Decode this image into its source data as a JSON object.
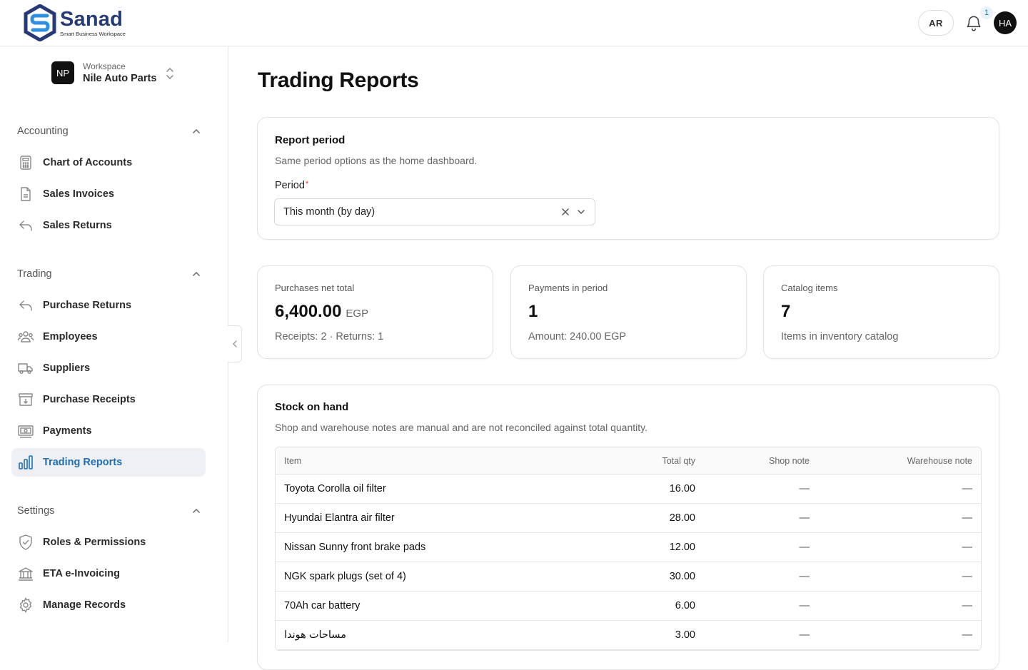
{
  "brand": {
    "name": "Sanad",
    "tagline": "Smart Business Workspace"
  },
  "header": {
    "lang_label": "AR",
    "notification_count": "1",
    "user_initials": "HA"
  },
  "workspace": {
    "initials": "NP",
    "label": "Workspace",
    "name": "Nile Auto Parts"
  },
  "sidebar": {
    "sections": [
      {
        "title": "Accounting",
        "items": [
          {
            "label": "Chart of Accounts",
            "icon": "calculator-icon"
          },
          {
            "label": "Sales Invoices",
            "icon": "document-icon"
          },
          {
            "label": "Sales Returns",
            "icon": "return-arrow-icon"
          }
        ]
      },
      {
        "title": "Trading",
        "items": [
          {
            "label": "Purchase Returns",
            "icon": "return-arrow-icon"
          },
          {
            "label": "Employees",
            "icon": "users-icon"
          },
          {
            "label": "Suppliers",
            "icon": "truck-icon"
          },
          {
            "label": "Purchase Receipts",
            "icon": "archive-box-icon"
          },
          {
            "label": "Payments",
            "icon": "banknote-icon"
          },
          {
            "label": "Trading Reports",
            "icon": "bar-chart-icon",
            "active": true
          }
        ]
      },
      {
        "title": "Settings",
        "items": [
          {
            "label": "Roles & Permissions",
            "icon": "shield-check-icon"
          },
          {
            "label": "ETA e-Invoicing",
            "icon": "bank-building-icon"
          },
          {
            "label": "Manage Records",
            "icon": "gear-icon"
          }
        ]
      }
    ]
  },
  "page": {
    "title": "Trading Reports"
  },
  "period_card": {
    "title": "Report period",
    "subtitle": "Same period options as the home dashboard.",
    "field_label": "Period",
    "required_mark": "*",
    "selected": "This month (by day)"
  },
  "stats": [
    {
      "label": "Purchases net total",
      "value": "6,400.00",
      "unit": "EGP",
      "footer": "Receipts: 2 · Returns: 1"
    },
    {
      "label": "Payments in period",
      "value": "1",
      "unit": "",
      "footer": "Amount: 240.00 EGP"
    },
    {
      "label": "Catalog items",
      "value": "7",
      "unit": "",
      "footer": "Items in inventory catalog"
    }
  ],
  "stock": {
    "title": "Stock on hand",
    "subtitle": "Shop and warehouse notes are manual and are not reconciled against total quantity.",
    "columns": [
      "Item",
      "Total qty",
      "Shop note",
      "Warehouse note"
    ],
    "rows": [
      {
        "item": "Toyota Corolla oil filter",
        "qty": "16.00",
        "shop": "—",
        "warehouse": "—"
      },
      {
        "item": "Hyundai Elantra air filter",
        "qty": "28.00",
        "shop": "—",
        "warehouse": "—"
      },
      {
        "item": "Nissan Sunny front brake pads",
        "qty": "12.00",
        "shop": "—",
        "warehouse": "—"
      },
      {
        "item": "NGK spark plugs (set of 4)",
        "qty": "30.00",
        "shop": "—",
        "warehouse": "—"
      },
      {
        "item": "70Ah car battery",
        "qty": "6.00",
        "shop": "—",
        "warehouse": "—"
      },
      {
        "item": "مساحات هوندا",
        "qty": "3.00",
        "shop": "—",
        "warehouse": "—"
      }
    ]
  },
  "colors": {
    "brand_navy": "#263a78",
    "brand_blue": "#1f6fb0",
    "active_bg": "#eef0f3"
  }
}
